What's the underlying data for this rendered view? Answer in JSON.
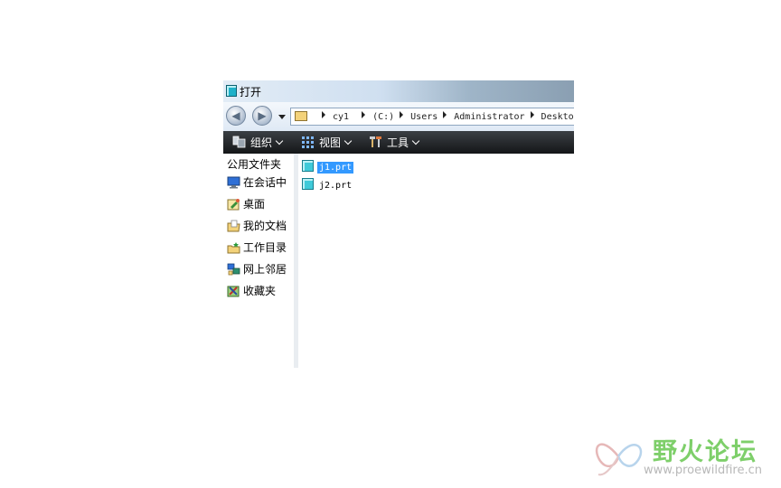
{
  "window": {
    "title": "打开"
  },
  "address": {
    "crumbs": [
      "cy1",
      "(C:)",
      "Users",
      "Administrator",
      "Desktop"
    ]
  },
  "toolbar": {
    "organize_label": "组织",
    "view_label": "视图",
    "tools_label": "工具"
  },
  "sidebar": {
    "header": "公用文件夹",
    "items": [
      {
        "label": "在会话中",
        "icon": "monitor-icon"
      },
      {
        "label": "桌面",
        "icon": "desktop-icon"
      },
      {
        "label": "我的文档",
        "icon": "documents-icon"
      },
      {
        "label": "工作目录",
        "icon": "working-folder-icon"
      },
      {
        "label": "网上邻居",
        "icon": "network-icon"
      },
      {
        "label": "收藏夹",
        "icon": "favorites-icon"
      }
    ]
  },
  "files": [
    {
      "name": "j1.prt",
      "selected": true
    },
    {
      "name": "j2.prt",
      "selected": false
    }
  ],
  "watermark": {
    "text": "野火论坛",
    "url": "www.proewildfire.cn"
  },
  "colors": {
    "selection": "#3399ff",
    "toolbar_bg": "#1e2124",
    "watermark_green": "#7ecf6a"
  }
}
